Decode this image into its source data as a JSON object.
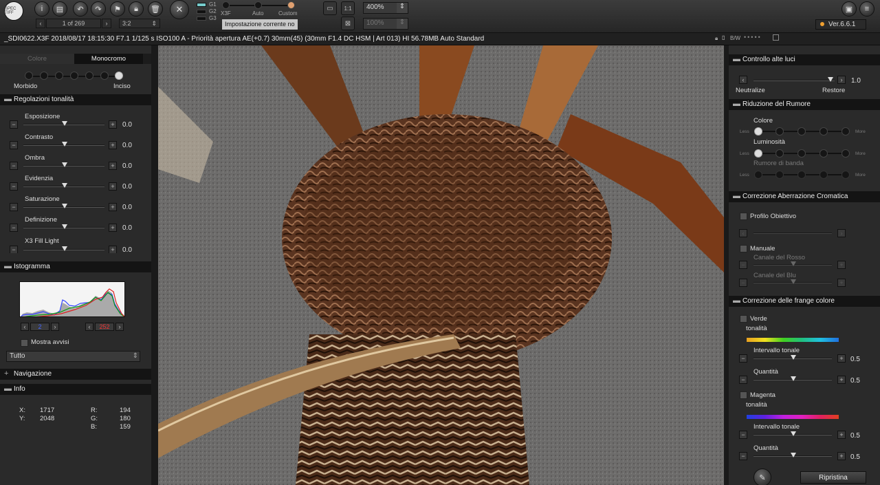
{
  "toolbar": {
    "logo": "SPEC TIFF",
    "nav_counter": "1 of 269",
    "aspect": "3:2",
    "gray_labels": [
      "G1",
      "G2",
      "G3"
    ],
    "mode_labels": [
      "X3F",
      "Auto",
      "Custom"
    ],
    "setting_current": "Impostazione corrente no",
    "zoom_1": "400%",
    "zoom_2": "100%",
    "version": "Ver.6.6.1"
  },
  "infobar": {
    "text": "_SDI0622.X3F 2018/08/17 18:15:30 F7.1 1/125 s ISO100 A - Priorità apertura AE(+0.7) 30mm(45) (30mm F1.4 DC HSM | Art 013) HI 56.78MB Auto Standard",
    "bw": "B/W"
  },
  "left": {
    "tabs": [
      "Colore",
      "Monocromo"
    ],
    "sharp_left": "Morbido",
    "sharp_right": "Inciso",
    "tonal_header": "Regolazioni tonalità",
    "sliders": [
      {
        "label": "Esposizione",
        "value": "0.0"
      },
      {
        "label": "Contrasto",
        "value": "0.0"
      },
      {
        "label": "Ombra",
        "value": "0.0"
      },
      {
        "label": "Evidenzia",
        "value": "0.0"
      },
      {
        "label": "Saturazione",
        "value": "0.0"
      },
      {
        "label": "Definizione",
        "value": "0.0"
      },
      {
        "label": "X3 Fill Light",
        "value": "0.0"
      }
    ],
    "hist_header": "Istogramma",
    "hist_low": "2",
    "hist_high": "252",
    "show_warn": "Mostra avvisi",
    "channel": "Tutto",
    "nav_header": "Navigazione",
    "info_header": "Info",
    "info": {
      "x_label": "X:",
      "x": "1717",
      "y_label": "Y:",
      "y": "2048",
      "r_label": "R:",
      "r": "194",
      "g_label": "G:",
      "g": "180",
      "b_label": "B:",
      "b": "159"
    }
  },
  "right": {
    "hl_header": "Controllo alte luci",
    "hl_value": "1.0",
    "hl_left": "Neutralize",
    "hl_right": "Restore",
    "nr_header": "Riduzione del Rumore",
    "nr_colore": "Colore",
    "nr_lum": "Luminosità",
    "nr_band": "Rumore di banda",
    "less": "Less",
    "more": "More",
    "ca_header": "Correzione Aberrazione Cromatica",
    "ca_profile": "Profilo Obiettivo",
    "ca_manual": "Manuale",
    "ca_red": "Canale del Rosso",
    "ca_blue": "Canale del Blu",
    "fringe_header": "Correzione delle frange colore",
    "green": "Verde",
    "magenta": "Magenta",
    "tonalita": "tonalità",
    "interval": "Intervallo tonale",
    "quantity": "Quantità",
    "val_05": "0.5",
    "reset": "Ripristina"
  },
  "colors": {
    "accent": "#f0a030",
    "panel": "#2a2a2a",
    "header": "#141414"
  }
}
